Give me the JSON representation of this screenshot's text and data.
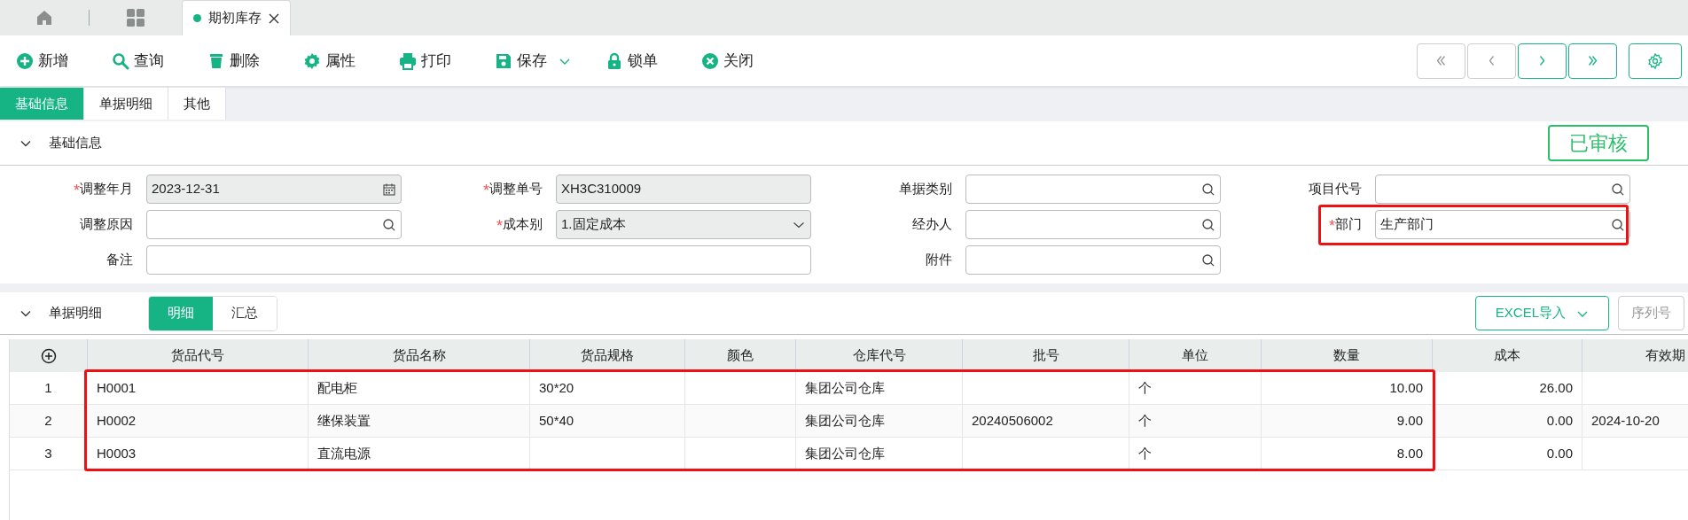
{
  "top_tabs": [
    {
      "kind": "home",
      "selected": false
    },
    {
      "kind": "grid",
      "selected": false
    },
    {
      "kind": "doc",
      "label": "期初库存",
      "selected": true
    }
  ],
  "toolbar": {
    "buttons": [
      {
        "label": "新增",
        "kind": "add",
        "dropdown": false
      },
      {
        "label": "查询",
        "kind": "search",
        "dropdown": false
      },
      {
        "label": "删除",
        "kind": "delete",
        "dropdown": false
      },
      {
        "label": "属性",
        "kind": "settings",
        "dropdown": false
      },
      {
        "label": "打印",
        "kind": "print",
        "dropdown": false
      },
      {
        "label": "保存",
        "kind": "save",
        "dropdown": true
      },
      {
        "label": "锁单",
        "kind": "lock",
        "dropdown": false
      },
      {
        "label": "关闭",
        "kind": "close",
        "dropdown": false
      }
    ],
    "nav": [
      {
        "kind": "first",
        "disabled": true
      },
      {
        "kind": "prev",
        "disabled": true
      },
      {
        "kind": "next",
        "disabled": false
      },
      {
        "kind": "last",
        "disabled": false
      }
    ]
  },
  "form_tabs": [
    {
      "label": "基础信息",
      "selected": true
    },
    {
      "label": "单据明细",
      "selected": false
    },
    {
      "label": "其他",
      "selected": false
    }
  ],
  "basic_section": {
    "title": "基础信息",
    "expanded": true,
    "status": "已审核",
    "fields": [
      {
        "required_mark": "*",
        "label": "调整年月",
        "value": "2023-12-31",
        "kind": "date",
        "readonly": true,
        "highlighted": false
      },
      {
        "required_mark": "*",
        "label": "调整单号",
        "value": "XH3C310009",
        "kind": "text",
        "readonly": true,
        "highlighted": false
      },
      {
        "label": "单据类别",
        "kind": "search",
        "readonly": false,
        "highlighted": false
      },
      {
        "label": "项目代号",
        "kind": "search",
        "readonly": false,
        "highlighted": false
      },
      {
        "label": "调整原因",
        "kind": "search",
        "readonly": false,
        "highlighted": false
      },
      {
        "required_mark": "*",
        "label": "成本别",
        "value": "1.固定成本",
        "kind": "select",
        "readonly": true,
        "highlighted": false
      },
      {
        "label": "经办人",
        "kind": "search",
        "readonly": false,
        "highlighted": false
      },
      {
        "required_mark": "*",
        "label": "部门",
        "value": "生产部门",
        "kind": "search",
        "readonly": false,
        "highlighted": true
      },
      {
        "label": "备注",
        "kind": "wide_text",
        "readonly": false,
        "highlighted": false
      },
      {
        "label": "附件",
        "kind": "search",
        "readonly": false,
        "highlighted": false
      }
    ]
  },
  "detail_section": {
    "title": "单据明细",
    "expanded": true,
    "views": [
      {
        "label": "明细",
        "selected": true
      },
      {
        "label": "汇总",
        "selected": false
      }
    ],
    "buttons": [
      {
        "label": "EXCEL导入",
        "dropdown": true,
        "disabled": false
      },
      {
        "label": "序列号",
        "dropdown": false,
        "disabled": true
      }
    ]
  },
  "table": {
    "highlighted": true,
    "columns": [
      {
        "kind": "index"
      },
      {
        "label": "货品代号",
        "kind": "text"
      },
      {
        "label": "货品名称",
        "kind": "text"
      },
      {
        "label": "货品规格",
        "kind": "text"
      },
      {
        "label": "颜色",
        "kind": "text"
      },
      {
        "label": "仓库代号",
        "kind": "text"
      },
      {
        "label": "批号",
        "kind": "text"
      },
      {
        "label": "单位",
        "kind": "text"
      },
      {
        "label": "数量",
        "kind": "number"
      },
      {
        "label": "成本",
        "kind": "number"
      },
      {
        "label": "有效期",
        "kind": "text"
      }
    ],
    "rows": [
      [
        "1",
        "H0001",
        "配电柜",
        "30*20",
        "",
        "集团公司仓库",
        "",
        "个",
        "10.00",
        "26.00",
        ""
      ],
      [
        "2",
        "H0002",
        "继保装置",
        "50*40",
        "",
        "集团公司仓库",
        "20240506002",
        "个",
        "9.00",
        "0.00",
        "2024-10-20"
      ],
      [
        "3",
        "H0003",
        "直流电源",
        "",
        "",
        "集团公司仓库",
        "",
        "个",
        "8.00",
        "0.00",
        ""
      ]
    ]
  }
}
